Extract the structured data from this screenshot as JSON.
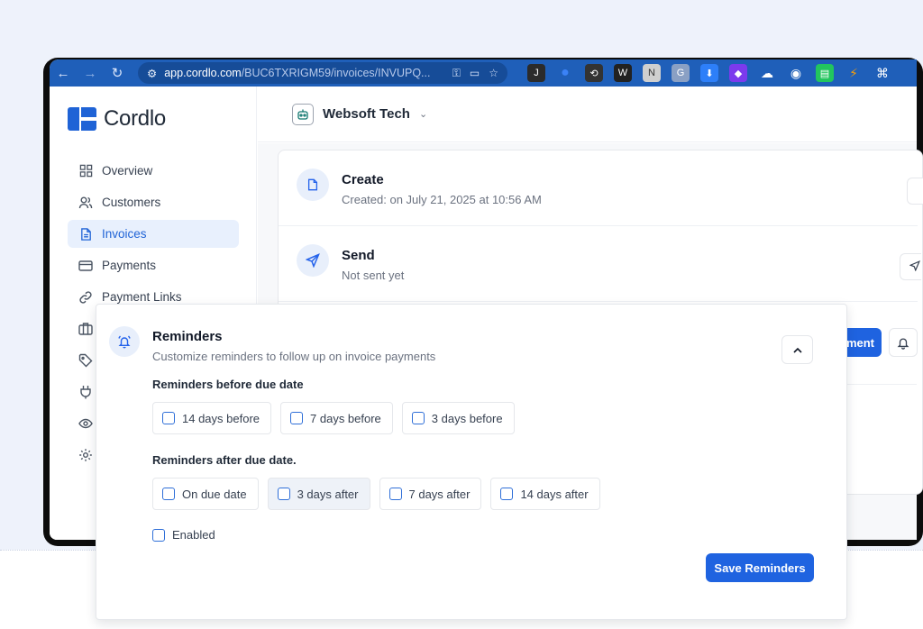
{
  "browser": {
    "url_host": "app.cordlo.com",
    "url_path": "/BUC6TXRIGM59/invoices/INVUPQ..."
  },
  "brand": {
    "name": "Cordlo",
    "accent": "#1f63d6"
  },
  "sidebar": {
    "items": [
      {
        "label": "Overview",
        "icon": "grid-icon"
      },
      {
        "label": "Customers",
        "icon": "users-icon"
      },
      {
        "label": "Invoices",
        "icon": "document-icon",
        "active": true
      },
      {
        "label": "Payments",
        "icon": "card-icon"
      },
      {
        "label": "Payment Links",
        "icon": "link-icon"
      }
    ],
    "extra_icons": [
      "briefcase-icon",
      "tag-icon",
      "plug-icon",
      "eye-icon",
      "gear-icon"
    ]
  },
  "header": {
    "org_name": "Websoft Tech"
  },
  "steps": [
    {
      "title": "Create",
      "subtitle": "Created: on July 21, 2025 at 10:56 AM",
      "icon": "document-icon"
    },
    {
      "title": "Send",
      "subtitle": "Not sent yet",
      "icon": "send-icon"
    }
  ],
  "partial_button_label": "ment",
  "reminders": {
    "title": "Reminders",
    "subtitle": "Customize reminders to follow up on invoice payments",
    "before_label": "Reminders before due date",
    "before_options": [
      "14 days before",
      "7 days before",
      "3 days before"
    ],
    "after_label": "Reminders after due date.",
    "after_options": [
      "On due date",
      "3 days after",
      "7 days after",
      "14 days after"
    ],
    "enabled_label": "Enabled",
    "save_label": "Save Reminders"
  }
}
